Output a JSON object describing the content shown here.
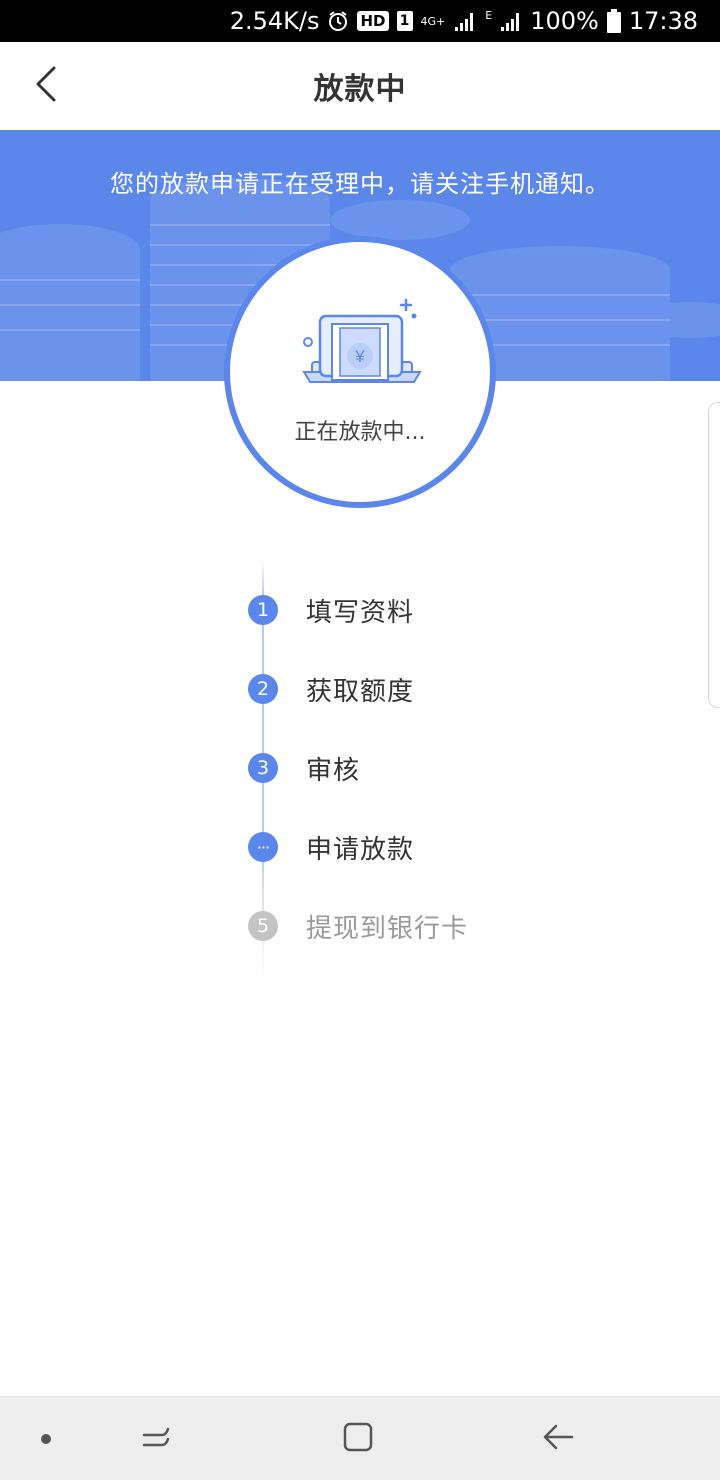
{
  "status_bar": {
    "speed": "2.54K/s",
    "hd": "HD",
    "sim": "1",
    "network_4g": "4G+",
    "network_e": "E",
    "battery": "100%",
    "time": "17:38"
  },
  "header": {
    "title": "放款中"
  },
  "banner": {
    "notice": "您的放款申请正在受理中，请关注手机通知。"
  },
  "status_card": {
    "text": "正在放款中...",
    "icon": "atm-yuan-icon"
  },
  "steps": [
    {
      "marker": "1",
      "label": "填写资料",
      "state": "done"
    },
    {
      "marker": "2",
      "label": "获取额度",
      "state": "done"
    },
    {
      "marker": "3",
      "label": "审核",
      "state": "done"
    },
    {
      "marker": "···",
      "label": "申请放款",
      "state": "current"
    },
    {
      "marker": "5",
      "label": "提现到银行卡",
      "state": "pending"
    }
  ],
  "colors": {
    "accent": "#5b87ea",
    "pending": "#c4c4c4",
    "text": "#333333"
  }
}
